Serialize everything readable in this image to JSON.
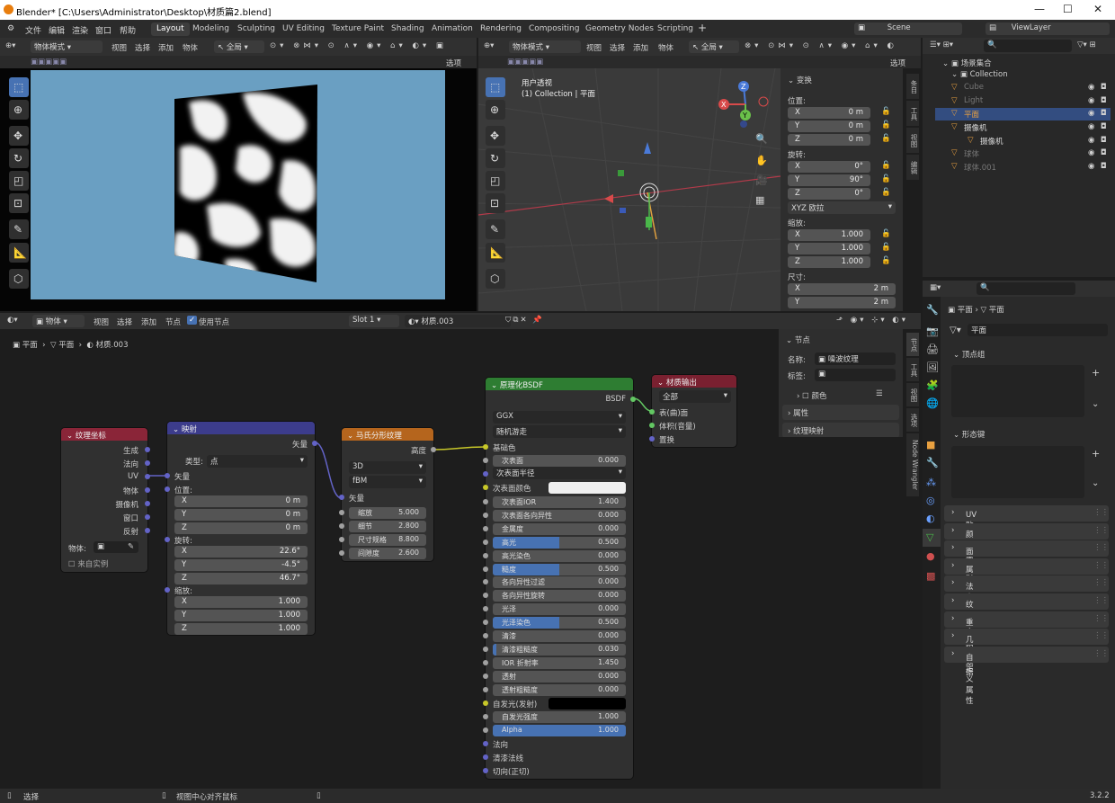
{
  "window": {
    "title": "Blender* [C:\\Users\\Administrator\\Desktop\\材质篇2.blend]"
  },
  "menus": [
    "文件",
    "编辑",
    "渲染",
    "窗口",
    "帮助"
  ],
  "workspace_tabs": [
    "Layout",
    "Modeling",
    "Sculpting",
    "UV Editing",
    "Texture Paint",
    "Shading",
    "Animation",
    "Rendering",
    "Compositing",
    "Geometry Nodes",
    "Scripting"
  ],
  "active_workspace": "Layout",
  "scene": "Scene",
  "view_layer": "ViewLayer",
  "left_viewport": {
    "mode": "物体模式",
    "menus": [
      "视图",
      "选择",
      "添加",
      "物体"
    ],
    "transform": "全局",
    "options": "选项"
  },
  "right_viewport": {
    "mode": "物体模式",
    "menus": [
      "视图",
      "选择",
      "添加",
      "物体"
    ],
    "transform": "全局",
    "options": "选项",
    "overlay_title": "用户透视",
    "overlay_sub": "(1) Collection | 平面"
  },
  "transform_panel": {
    "title": "变换",
    "location_label": "位置:",
    "location": [
      {
        "a": "X",
        "v": "0 m"
      },
      {
        "a": "Y",
        "v": "0 m"
      },
      {
        "a": "Z",
        "v": "0 m"
      }
    ],
    "rotation_label": "旋转:",
    "rotation": [
      {
        "a": "X",
        "v": "0°"
      },
      {
        "a": "Y",
        "v": "90°"
      },
      {
        "a": "Z",
        "v": "0°"
      }
    ],
    "rotation_mode": "XYZ 欧拉",
    "scale_label": "缩放:",
    "scale": [
      {
        "a": "X",
        "v": "1.000"
      },
      {
        "a": "Y",
        "v": "1.000"
      },
      {
        "a": "Z",
        "v": "1.000"
      }
    ],
    "dims_label": "尺寸:",
    "dims": [
      {
        "a": "X",
        "v": "2 m"
      },
      {
        "a": "Y",
        "v": "2 m"
      }
    ]
  },
  "n_tabs": [
    "条目",
    "工具",
    "视图",
    "编辑"
  ],
  "outliner": {
    "search_placeholder": "",
    "title": "场景集合",
    "collection": "Collection",
    "items": [
      {
        "name": "Cube"
      },
      {
        "name": "Light"
      },
      {
        "name": "平面"
      },
      {
        "name": "摄像机"
      },
      {
        "name": "摄像机"
      },
      {
        "name": "球体"
      },
      {
        "name": "球体.001"
      }
    ]
  },
  "node_editor": {
    "header": {
      "object": "物体",
      "menus": [
        "视图",
        "选择",
        "添加",
        "节点"
      ],
      "use_nodes": "使用节点",
      "slot": "Slot 1",
      "material": "材质.003"
    },
    "breadcrumb": [
      "平面",
      "平面",
      "材质.003"
    ],
    "nodes": {
      "texcoord": {
        "title": "纹理坐标",
        "outputs": [
          "生成",
          "法向",
          "UV",
          "物体",
          "摄像机",
          "窗口",
          "反射"
        ],
        "object_label": "物体:",
        "from_instancer": "来自实例"
      },
      "mapping": {
        "title": "映射",
        "output": "矢量",
        "type_label": "类型:",
        "type_value": "点",
        "vector": "矢量",
        "loc_label": "位置:",
        "loc": [
          {
            "a": "X",
            "v": "0 m"
          },
          {
            "a": "Y",
            "v": "0 m"
          },
          {
            "a": "Z",
            "v": "0 m"
          }
        ],
        "rot_label": "旋转:",
        "rot": [
          {
            "a": "X",
            "v": "22.6°"
          },
          {
            "a": "Y",
            "v": "-4.5°"
          },
          {
            "a": "Z",
            "v": "46.7°"
          }
        ],
        "scale_label": "缩放:",
        "scale": [
          {
            "a": "X",
            "v": "1.000"
          },
          {
            "a": "Y",
            "v": "1.000"
          },
          {
            "a": "Z",
            "v": "1.000"
          }
        ]
      },
      "musgrave": {
        "title": "马氏分形纹理",
        "output": "高度",
        "dim": "3D",
        "kind": "fBM",
        "vector": "矢量",
        "props": [
          {
            "l": "缩放",
            "v": "5.000"
          },
          {
            "l": "细节",
            "v": "2.800"
          },
          {
            "l": "尺寸规格",
            "v": "8.800"
          },
          {
            "l": "间隙度",
            "v": "2.600"
          }
        ]
      },
      "bsdf": {
        "title": "原理化BSDF",
        "output": "BSDF",
        "dist": "GGX",
        "sss": "随机游走",
        "base_color": "基础色",
        "sss_radius": "次表面半径",
        "sss_color": "次表面颜色",
        "props": [
          {
            "l": "次表面",
            "v": "0.000",
            "f": 0
          },
          {
            "l": "次表面IOR",
            "v": "1.400",
            "f": 0.3
          },
          {
            "l": "次表面各向异性",
            "v": "0.000",
            "f": 0
          },
          {
            "l": "金属度",
            "v": "0.000",
            "f": 0
          },
          {
            "l": "高光",
            "v": "0.500",
            "f": 0.5
          },
          {
            "l": "高光染色",
            "v": "0.000",
            "f": 0
          },
          {
            "l": "糙度",
            "v": "0.500",
            "f": 0.5
          },
          {
            "l": "各向异性过滤",
            "v": "0.000",
            "f": 0
          },
          {
            "l": "各向异性旋转",
            "v": "0.000",
            "f": 0
          },
          {
            "l": "光泽",
            "v": "0.000",
            "f": 0
          },
          {
            "l": "光泽染色",
            "v": "0.500",
            "f": 0.5
          },
          {
            "l": "清漆",
            "v": "0.000",
            "f": 0
          },
          {
            "l": "清漆粗糙度",
            "v": "0.030",
            "f": 0.03
          },
          {
            "l": "IOR 折射率",
            "v": "1.450",
            "f": 0
          },
          {
            "l": "透射",
            "v": "0.000",
            "f": 0
          },
          {
            "l": "透射粗糙度",
            "v": "0.000",
            "f": 0
          }
        ],
        "emission": "自发光(发射)",
        "emission_strength": {
          "l": "自发光强度",
          "v": "1.000"
        },
        "alpha": {
          "l": "Alpha",
          "v": "1.000"
        },
        "bottom": [
          "法向",
          "清漆法线",
          "切向(正切)"
        ]
      },
      "output": {
        "title": "材质输出",
        "target": "全部",
        "inputs": [
          "表(曲)面",
          "体积(音量)",
          "置换"
        ]
      }
    },
    "side": {
      "title": "节点",
      "name_label": "名称:",
      "name_value": "噪波纹理",
      "label_label": "标签:",
      "color": "颜色",
      "attrs": "属性",
      "tex_map": "纹理映射"
    },
    "tabs": [
      "节点",
      "工具",
      "视图",
      "选项",
      "Node Wrangler"
    ]
  },
  "properties": {
    "breadcrumb": [
      "平面",
      "平面"
    ],
    "data_name": "平面",
    "vgroups": "顶点组",
    "shapekeys": "形态键",
    "sections": [
      "UV 贴图",
      "颜色属性",
      "面映射",
      "属性",
      "法向",
      "纹理空间",
      "重构网格",
      "几何数据",
      "自定义属性"
    ]
  },
  "status": {
    "select": "选择",
    "center": "视图中心对齐鼠标",
    "version": "3.2.2"
  },
  "colors": {
    "accent": "#4772b3",
    "shader_green": "#2e7d32",
    "tex_orange": "#b5651d",
    "vec_purple": "#3c3c8c",
    "input_red": "#8a2538",
    "output_red": "#7a2030"
  }
}
